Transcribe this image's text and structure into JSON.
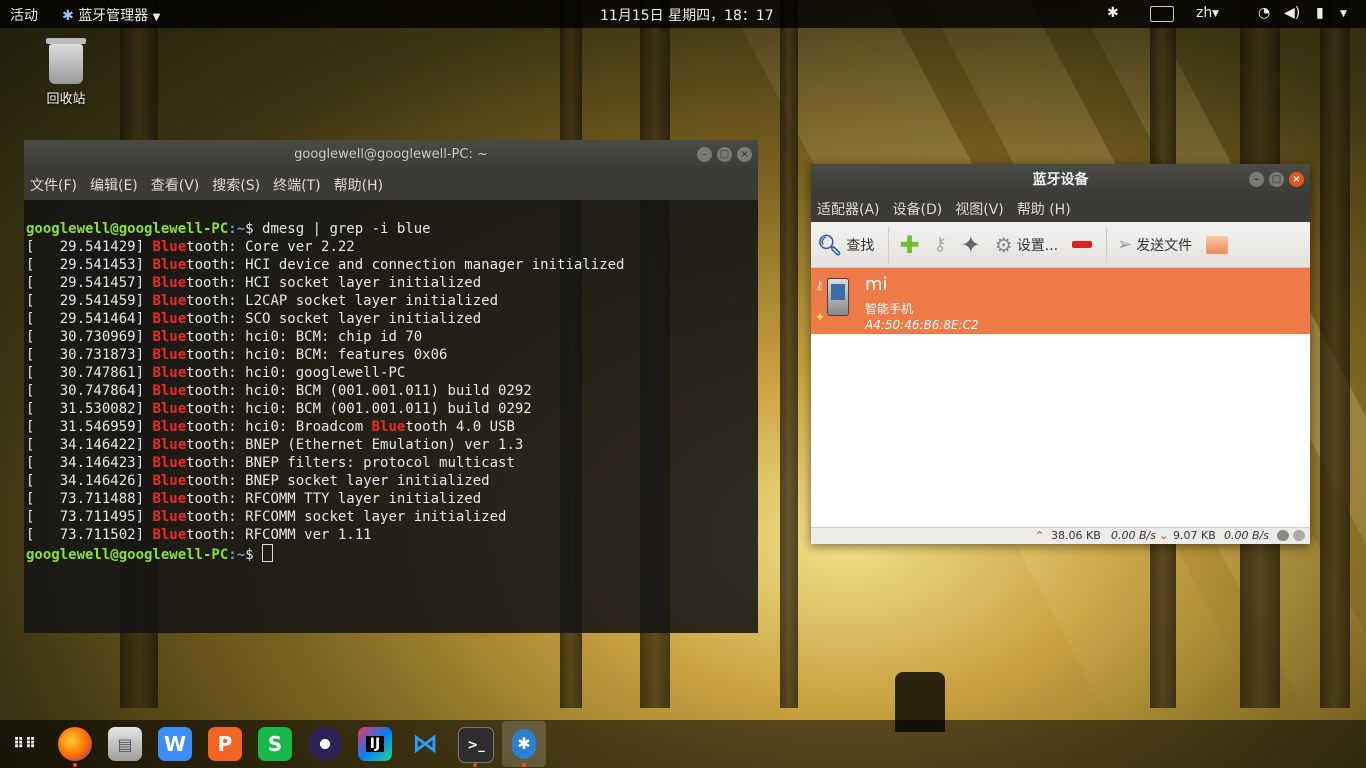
{
  "topbar": {
    "activities": "活动",
    "app_menu": "蓝牙管理器",
    "clock": "11月15日 星期四，18：17",
    "lang": "zh"
  },
  "desktop": {
    "trash_label": "回收站"
  },
  "terminal": {
    "title": "googlewell@googlewell-PC: ~",
    "menu": [
      "文件(F)",
      "编辑(E)",
      "查看(V)",
      "搜索(S)",
      "终端(T)",
      "帮助(H)"
    ],
    "prompt_user": "googlewell@googlewell-PC",
    "prompt_path": ":~",
    "command": "$ dmesg | grep -i blue",
    "lines": [
      {
        "ts": "[   29.541429] ",
        "hl": "Blue",
        "rest": "tooth: Core ver 2.22"
      },
      {
        "ts": "[   29.541453] ",
        "hl": "Blue",
        "rest": "tooth: HCI device and connection manager initialized"
      },
      {
        "ts": "[   29.541457] ",
        "hl": "Blue",
        "rest": "tooth: HCI socket layer initialized"
      },
      {
        "ts": "[   29.541459] ",
        "hl": "Blue",
        "rest": "tooth: L2CAP socket layer initialized"
      },
      {
        "ts": "[   29.541464] ",
        "hl": "Blue",
        "rest": "tooth: SCO socket layer initialized"
      },
      {
        "ts": "[   30.730969] ",
        "hl": "Blue",
        "rest": "tooth: hci0: BCM: chip id 70"
      },
      {
        "ts": "[   30.731873] ",
        "hl": "Blue",
        "rest": "tooth: hci0: BCM: features 0x06"
      },
      {
        "ts": "[   30.747861] ",
        "hl": "Blue",
        "rest": "tooth: hci0: googlewell-PC"
      },
      {
        "ts": "[   30.747864] ",
        "hl": "Blue",
        "rest": "tooth: hci0: BCM (001.001.011) build 0292"
      },
      {
        "ts": "[   31.530082] ",
        "hl": "Blue",
        "rest": "tooth: hci0: BCM (001.001.011) build 0292"
      },
      {
        "ts": "[   31.546959] ",
        "hl": "Blue",
        "rest": "tooth: hci0: Broadcom ",
        "hl2": "Blue",
        "rest2": "tooth 4.0 USB"
      },
      {
        "ts": "[   34.146422] ",
        "hl": "Blue",
        "rest": "tooth: BNEP (Ethernet Emulation) ver 1.3"
      },
      {
        "ts": "[   34.146423] ",
        "hl": "Blue",
        "rest": "tooth: BNEP filters: protocol multicast"
      },
      {
        "ts": "[   34.146426] ",
        "hl": "Blue",
        "rest": "tooth: BNEP socket layer initialized"
      },
      {
        "ts": "[   73.711488] ",
        "hl": "Blue",
        "rest": "tooth: RFCOMM TTY layer initialized"
      },
      {
        "ts": "[   73.711495] ",
        "hl": "Blue",
        "rest": "tooth: RFCOMM socket layer initialized"
      },
      {
        "ts": "[   73.711502] ",
        "hl": "Blue",
        "rest": "tooth: RFCOMM ver 1.11"
      }
    ],
    "final_prompt": "$ "
  },
  "bluetooth": {
    "title": "蓝牙设备",
    "menu": [
      "适配器(A)",
      "设备(D)",
      "视图(V)",
      "帮助 (H)"
    ],
    "tools": {
      "search": "查找",
      "settings": "设置...",
      "send": "发送文件"
    },
    "device": {
      "name": "mi",
      "type": "智能手机",
      "address": "A4:50:46:B6:8E:C2"
    },
    "status": {
      "up_total": "38.06 KB",
      "up_rate": "0.00 B/s",
      "down_total": "9.07 KB",
      "down_rate": "0.00 B/s"
    }
  },
  "colors": {
    "accent": "#e95420",
    "selection": "#ee7a48",
    "prompt_green": "#8ae234",
    "prompt_blue": "#729fcf",
    "highlight_red": "#ef2929"
  },
  "dock": {
    "apps": [
      "app-grid-icon",
      "firefox-icon",
      "file-manager-icon",
      "wps-writer-icon",
      "wps-presentation-icon",
      "wps-spreadsheet-icon",
      "eclipse-icon",
      "intellij-icon",
      "vscode-icon",
      "terminal-icon",
      "bluetooth-icon"
    ]
  }
}
